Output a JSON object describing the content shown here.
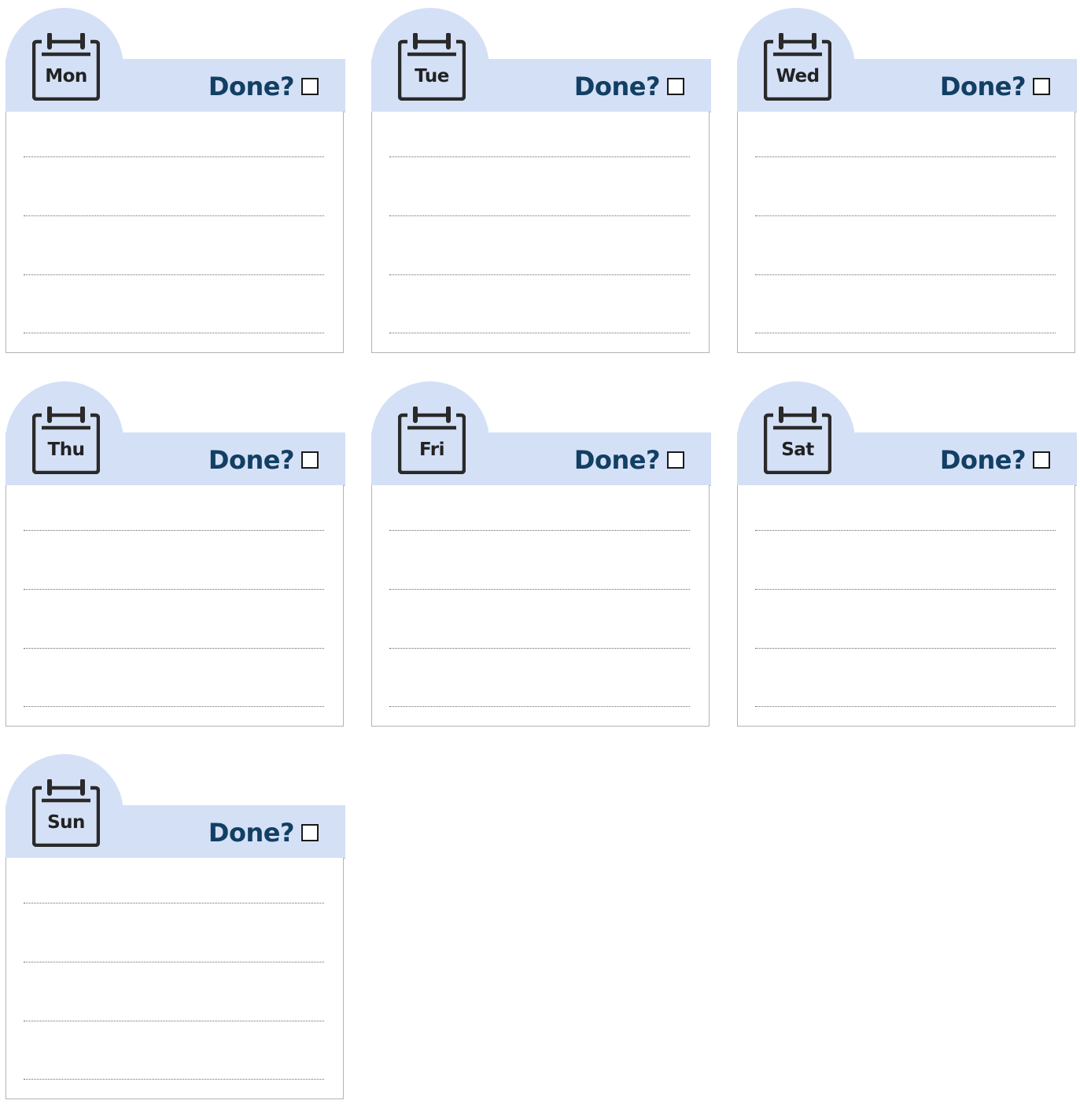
{
  "done_label": "Done?",
  "icon": "calendar-icon",
  "checkbox_icon": "empty-checkbox-icon",
  "colors": {
    "header_band": "#d4e0f6",
    "done_text": "#123f63",
    "icon_stroke": "#2a2a2a",
    "card_border": "#b3b3b3",
    "dotted_line": "#6a6a6a"
  },
  "lines_per_card": 4,
  "days": [
    {
      "label": "Mon",
      "done": false
    },
    {
      "label": "Tue",
      "done": false
    },
    {
      "label": "Wed",
      "done": false
    },
    {
      "label": "Thu",
      "done": false
    },
    {
      "label": "Fri",
      "done": false
    },
    {
      "label": "Sat",
      "done": false
    },
    {
      "label": "Sun",
      "done": false
    }
  ]
}
